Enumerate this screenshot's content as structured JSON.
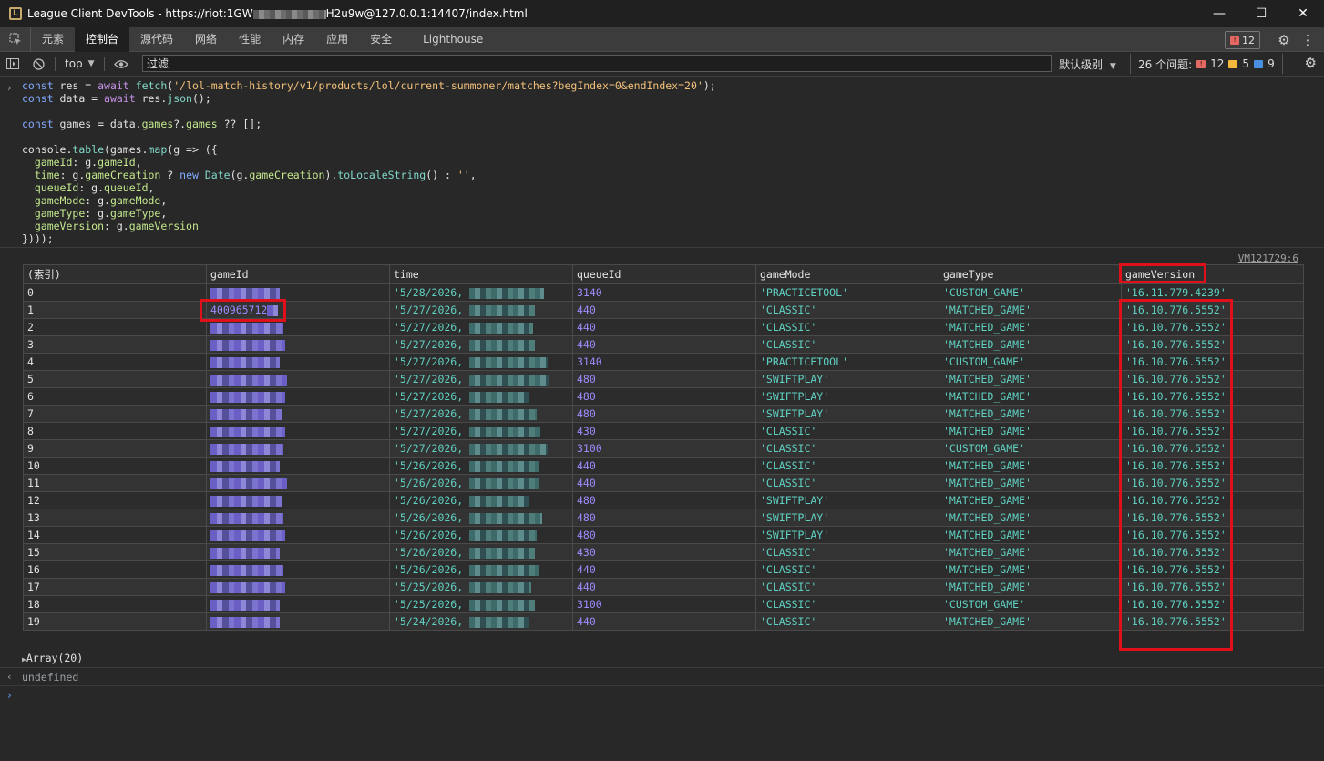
{
  "window": {
    "title_prefix": "League Client DevTools - https://riot:1GW",
    "title_suffix": "H2u9w@127.0.0.1:14407/index.html",
    "minimize": "—",
    "maximize": "☐",
    "close": "✕"
  },
  "tabs": [
    {
      "label": "元素"
    },
    {
      "label": "控制台"
    },
    {
      "label": "源代码"
    },
    {
      "label": "网络"
    },
    {
      "label": "性能"
    },
    {
      "label": "内存"
    },
    {
      "label": "应用"
    },
    {
      "label": "安全"
    },
    {
      "label": "Lighthouse"
    }
  ],
  "issue_badge_count": "12",
  "toolbar": {
    "context": "top",
    "filter_placeholder": "过滤",
    "levels": "默认级别",
    "issues_label": "26 个问题:",
    "issues_red": "12",
    "issues_yellow": "5",
    "issues_blue": "9"
  },
  "vm_link": "VM121729:6",
  "table": {
    "headers": [
      "(索引)",
      "gameId",
      "time",
      "queueId",
      "gameMode",
      "gameType",
      "gameVersion"
    ],
    "rows": [
      {
        "index": "0",
        "gameId": "",
        "time": "'5/28/2026, ",
        "queueId": "3140",
        "gameMode": "'PRACTICETOOL'",
        "gameType": "'CUSTOM_GAME'",
        "gameVersion": "'16.11.779.4239'"
      },
      {
        "index": "1",
        "gameId": "400965712",
        "time": "'5/27/2026, ",
        "queueId": "440",
        "gameMode": "'CLASSIC'",
        "gameType": "'MATCHED_GAME'",
        "gameVersion": "'16.10.776.5552'"
      },
      {
        "index": "2",
        "gameId": "",
        "time": "'5/27/2026, ",
        "queueId": "440",
        "gameMode": "'CLASSIC'",
        "gameType": "'MATCHED_GAME'",
        "gameVersion": "'16.10.776.5552'"
      },
      {
        "index": "3",
        "gameId": "",
        "time": "'5/27/2026, ",
        "queueId": "440",
        "gameMode": "'CLASSIC'",
        "gameType": "'MATCHED_GAME'",
        "gameVersion": "'16.10.776.5552'"
      },
      {
        "index": "4",
        "gameId": "",
        "time": "'5/27/2026, ",
        "queueId": "3140",
        "gameMode": "'PRACTICETOOL'",
        "gameType": "'CUSTOM_GAME'",
        "gameVersion": "'16.10.776.5552'"
      },
      {
        "index": "5",
        "gameId": "",
        "time": "'5/27/2026, ",
        "queueId": "480",
        "gameMode": "'SWIFTPLAY'",
        "gameType": "'MATCHED_GAME'",
        "gameVersion": "'16.10.776.5552'"
      },
      {
        "index": "6",
        "gameId": "",
        "time": "'5/27/2026, ",
        "queueId": "480",
        "gameMode": "'SWIFTPLAY'",
        "gameType": "'MATCHED_GAME'",
        "gameVersion": "'16.10.776.5552'"
      },
      {
        "index": "7",
        "gameId": "",
        "time": "'5/27/2026, ",
        "queueId": "480",
        "gameMode": "'SWIFTPLAY'",
        "gameType": "'MATCHED_GAME'",
        "gameVersion": "'16.10.776.5552'"
      },
      {
        "index": "8",
        "gameId": "",
        "time": "'5/27/2026, ",
        "queueId": "430",
        "gameMode": "'CLASSIC'",
        "gameType": "'MATCHED_GAME'",
        "gameVersion": "'16.10.776.5552'"
      },
      {
        "index": "9",
        "gameId": "",
        "time": "'5/27/2026, ",
        "queueId": "3100",
        "gameMode": "'CLASSIC'",
        "gameType": "'CUSTOM_GAME'",
        "gameVersion": "'16.10.776.5552'"
      },
      {
        "index": "10",
        "gameId": "",
        "time": "'5/26/2026, ",
        "queueId": "440",
        "gameMode": "'CLASSIC'",
        "gameType": "'MATCHED_GAME'",
        "gameVersion": "'16.10.776.5552'"
      },
      {
        "index": "11",
        "gameId": "",
        "time": "'5/26/2026, ",
        "queueId": "440",
        "gameMode": "'CLASSIC'",
        "gameType": "'MATCHED_GAME'",
        "gameVersion": "'16.10.776.5552'"
      },
      {
        "index": "12",
        "gameId": "",
        "time": "'5/26/2026, ",
        "queueId": "480",
        "gameMode": "'SWIFTPLAY'",
        "gameType": "'MATCHED_GAME'",
        "gameVersion": "'16.10.776.5552'"
      },
      {
        "index": "13",
        "gameId": "",
        "time": "'5/26/2026, ",
        "queueId": "480",
        "gameMode": "'SWIFTPLAY'",
        "gameType": "'MATCHED_GAME'",
        "gameVersion": "'16.10.776.5552'"
      },
      {
        "index": "14",
        "gameId": "",
        "time": "'5/26/2026, ",
        "queueId": "480",
        "gameMode": "'SWIFTPLAY'",
        "gameType": "'MATCHED_GAME'",
        "gameVersion": "'16.10.776.5552'"
      },
      {
        "index": "15",
        "gameId": "",
        "time": "'5/26/2026, ",
        "queueId": "430",
        "gameMode": "'CLASSIC'",
        "gameType": "'MATCHED_GAME'",
        "gameVersion": "'16.10.776.5552'"
      },
      {
        "index": "16",
        "gameId": "",
        "time": "'5/26/2026, ",
        "queueId": "440",
        "gameMode": "'CLASSIC'",
        "gameType": "'MATCHED_GAME'",
        "gameVersion": "'16.10.776.5552'"
      },
      {
        "index": "17",
        "gameId": "",
        "time": "'5/25/2026, ",
        "queueId": "440",
        "gameMode": "'CLASSIC'",
        "gameType": "'MATCHED_GAME'",
        "gameVersion": "'16.10.776.5552'"
      },
      {
        "index": "18",
        "gameId": "",
        "time": "'5/25/2026, ",
        "queueId": "3100",
        "gameMode": "'CLASSIC'",
        "gameType": "'CUSTOM_GAME'",
        "gameVersion": "'16.10.776.5552'"
      },
      {
        "index": "19",
        "gameId": "",
        "time": "'5/24/2026, ",
        "queueId": "440",
        "gameMode": "'CLASSIC'",
        "gameType": "'MATCHED_GAME'",
        "gameVersion": "'16.10.776.5552'"
      }
    ]
  },
  "array_label": "Array(20)",
  "undefined_label": "undefined",
  "colors": {
    "highlight": "#e0101b",
    "number": "#9d8cff",
    "string": "#5fd1c2"
  }
}
